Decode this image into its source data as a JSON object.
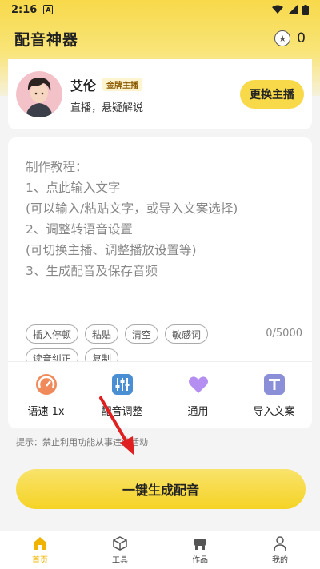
{
  "status_bar": {
    "time": "2:16",
    "notification_badge": "A"
  },
  "app_bar": {
    "title": "配音神器",
    "coin_count": "0"
  },
  "anchor": {
    "name": "艾伦",
    "badge": "金牌主播",
    "description": "直播，悬疑解说",
    "change_button": "更换主播"
  },
  "editor": {
    "tutorial_lines": [
      "制作教程：",
      "1、点此输入文字",
      " (可以输入/粘贴文字，或导入文案选择)",
      "2、调整转语音设置",
      " (可切换主播、调整播放设置等)",
      "3、生成配音及保存音频"
    ],
    "chips": [
      "插入停顿",
      "粘贴",
      "清空",
      "敏感词",
      "读音纠正",
      "复制"
    ],
    "counter": "0/5000"
  },
  "tools": [
    {
      "label": "语速 1x",
      "icon": "speed-gauge-icon",
      "color": "#f08a5a"
    },
    {
      "label": "配音调整",
      "icon": "sliders-icon",
      "color": "#4a8fd4"
    },
    {
      "label": "通用",
      "icon": "heart-icon",
      "color": "#b48ef0"
    },
    {
      "label": "导入文案",
      "icon": "text-t-icon",
      "color": "#8a8fd8"
    }
  ],
  "tip": "提示：禁止利用功能从事违法活动",
  "generate_button": "一键生成配音",
  "bottom_nav": [
    {
      "label": "首页",
      "icon": "home-icon",
      "active": true
    },
    {
      "label": "工具",
      "icon": "box-icon",
      "active": false
    },
    {
      "label": "作品",
      "icon": "works-icon",
      "active": false
    },
    {
      "label": "我的",
      "icon": "person-icon",
      "active": false
    }
  ],
  "colors": {
    "accent": "#f7d94a",
    "active_nav": "#f0b400",
    "arrow": "#e02020"
  }
}
